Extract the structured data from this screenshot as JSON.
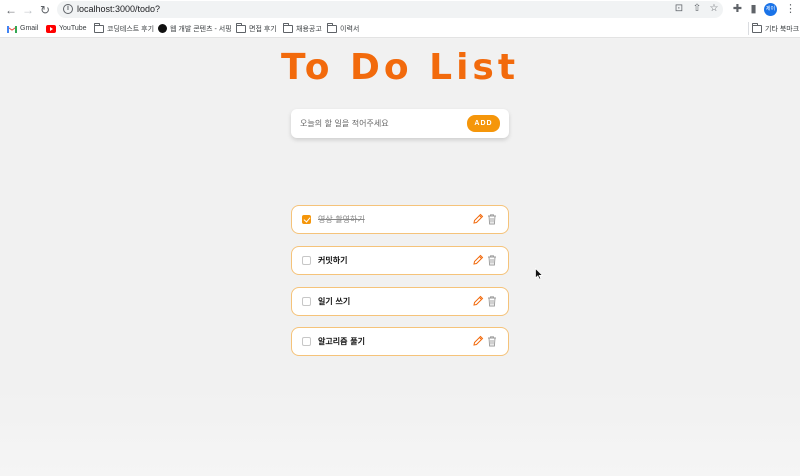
{
  "browser": {
    "url": "localhost:3000/todo?",
    "profile_label": "제이",
    "bookmarks": [
      {
        "label": "Gmail",
        "icon": "gmail-icon"
      },
      {
        "label": "YouTube",
        "icon": "youtube-icon"
      },
      {
        "label": "코딩테스트 후기",
        "icon": "folder-icon"
      },
      {
        "label": "웹 개발 콘텐츠 - 서핑",
        "icon": "velog-icon"
      },
      {
        "label": "면접 후기",
        "icon": "folder-icon"
      },
      {
        "label": "채용공고",
        "icon": "folder-icon"
      },
      {
        "label": "이력서",
        "icon": "folder-icon"
      }
    ],
    "other_bookmarks": "기타 북마크"
  },
  "app": {
    "title": "To Do List",
    "input_placeholder": "오늘의 할 일을 적어주세요",
    "add_label": "ADD",
    "accent_color": "#f26a0c",
    "button_color": "#f5960a",
    "todos": [
      {
        "text": "영상 촬영하기",
        "done": true
      },
      {
        "text": "커밋하기",
        "done": false
      },
      {
        "text": "일기 쓰기",
        "done": false
      },
      {
        "text": "알고리즘 풀기",
        "done": false
      }
    ]
  }
}
